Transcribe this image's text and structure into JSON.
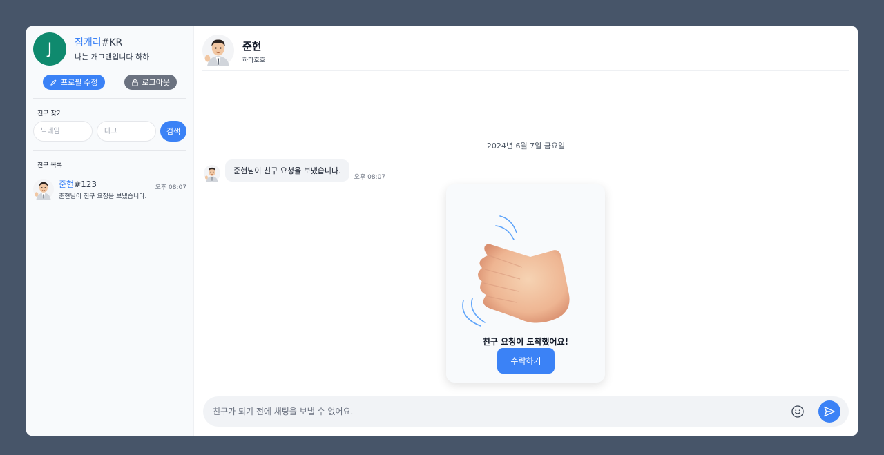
{
  "user": {
    "avatar_letter": "J",
    "nickname": "짐캐리",
    "tag": "#KR",
    "status": "나는 개그맨입니다 하하",
    "avatar_color": "#0f8a6e"
  },
  "profile_actions": {
    "edit_label": "프로필 수정",
    "logout_label": "로그아웃"
  },
  "find_friends": {
    "title": "친구 찾기",
    "nickname_placeholder": "닉네임",
    "tag_placeholder": "태그",
    "search_label": "검색"
  },
  "friend_list": {
    "title": "친구 목록",
    "items": [
      {
        "nickname": "준현",
        "tag": "#123",
        "last_message": "준현님이 친구 요청을 보냈습니다.",
        "time": "오후 08:07"
      }
    ]
  },
  "chat": {
    "name": "준현",
    "status": "하하호호",
    "date": "2024년 6월 7일 금요일",
    "messages": [
      {
        "text": "준현님이 친구 요청을 보냈습니다.",
        "time": "오후 08:07"
      }
    ],
    "request_card": {
      "title": "친구 요청이 도착했어요!",
      "accept_label": "수락하기"
    },
    "composer_placeholder": "친구가 되기 전에 채팅을 보낼 수 없어요."
  },
  "colors": {
    "accent": "#3b82f6",
    "background": "#475569",
    "logout_button": "#6b7280"
  },
  "icons": [
    "pencil-icon",
    "unlock-icon",
    "emoji-icon",
    "send-icon"
  ]
}
